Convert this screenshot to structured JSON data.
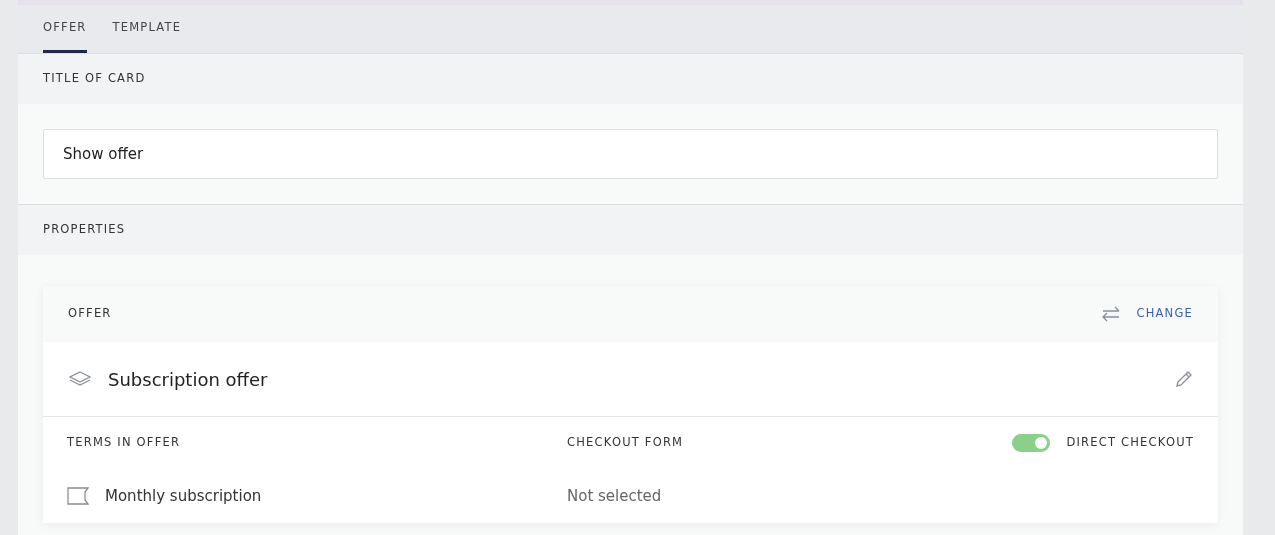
{
  "tabs": [
    {
      "label": "OFFER",
      "selected": true
    },
    {
      "label": "TEMPLATE",
      "selected": false
    }
  ],
  "title_section": {
    "heading": "TITLE OF CARD",
    "field_value": "Show offer"
  },
  "properties": {
    "heading": "PROPERTIES",
    "offer_card": {
      "heading": "OFFER",
      "change_label": "CHANGE",
      "offer_name": "Subscription offer",
      "terms_heading": "TERMS IN OFFER",
      "checkout_heading": "CHECKOUT FORM",
      "direct_checkout": {
        "label": "DIRECT CHECKOUT",
        "on": true
      },
      "term": "Monthly subscription",
      "checkout_value": "Not selected"
    }
  }
}
